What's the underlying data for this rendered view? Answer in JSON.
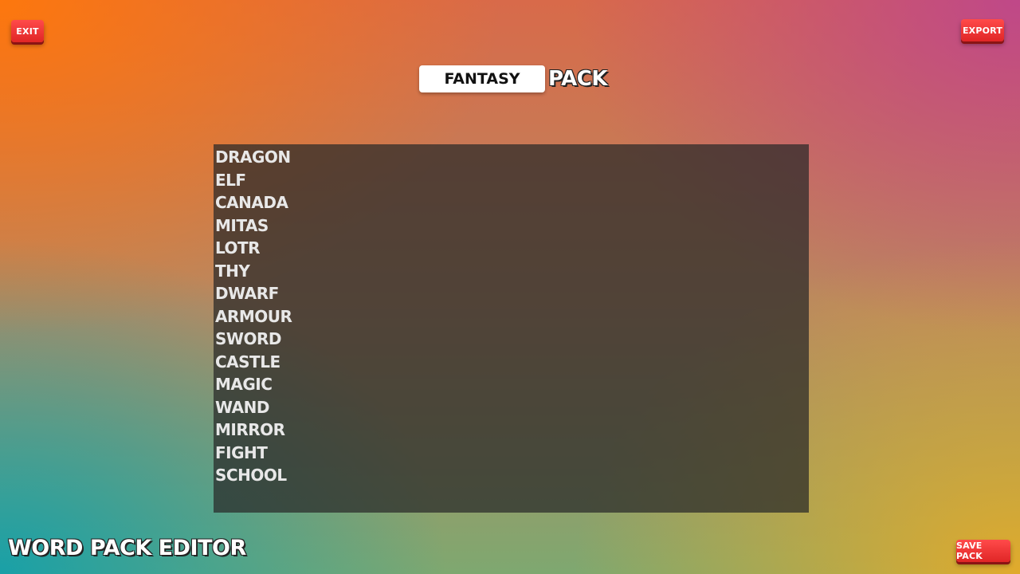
{
  "toolbar": {
    "exit_label": "EXIT",
    "export_label": "EXPORT",
    "save_label": "SAVE PACK"
  },
  "pack": {
    "name_value": "FANTASY",
    "suffix": "PACK"
  },
  "words": [
    "DRAGON",
    "ELF",
    "CANADA",
    "MITAS",
    "LOTR",
    "THY",
    "DWARF",
    "ARMOUR",
    "SWORD",
    "CASTLE",
    "MAGIC",
    "WAND",
    "MIRROR",
    "FIGHT",
    "SCHOOL"
  ],
  "app": {
    "title": "WORD PACK EDITOR"
  },
  "colors": {
    "button_red": "#e02626",
    "panel_bg": "#282828",
    "text_light": "#e8e8e8"
  }
}
